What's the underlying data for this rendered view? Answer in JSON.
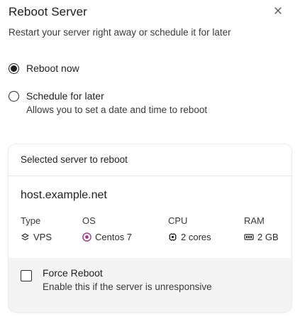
{
  "dialog": {
    "title": "Reboot Server",
    "subtitle": "Restart your server right away or schedule it for later"
  },
  "options": {
    "reboot_now": {
      "label": "Reboot now",
      "selected": true
    },
    "schedule": {
      "label": "Schedule for later",
      "description": "Allows you to set a date and time to reboot",
      "selected": false
    }
  },
  "server": {
    "header": "Selected server to reboot",
    "hostname": "host.example.net",
    "specs": {
      "type": {
        "label": "Type",
        "value": "VPS",
        "icon": "vps-icon"
      },
      "os": {
        "label": "OS",
        "value": "Centos 7",
        "icon": "centos-icon"
      },
      "cpu": {
        "label": "CPU",
        "value": "2 cores",
        "icon": "cpu-icon"
      },
      "ram": {
        "label": "RAM",
        "value": "2 GB",
        "icon": "ram-icon"
      }
    }
  },
  "force_reboot": {
    "label": "Force Reboot",
    "description": "Enable this if the server is unresponsive",
    "checked": false
  },
  "colors": {
    "text": "#1f1f1f",
    "muted": "#3a3a3a",
    "os_icon": "#a0358e",
    "force_bg": "#f4f4f4"
  }
}
